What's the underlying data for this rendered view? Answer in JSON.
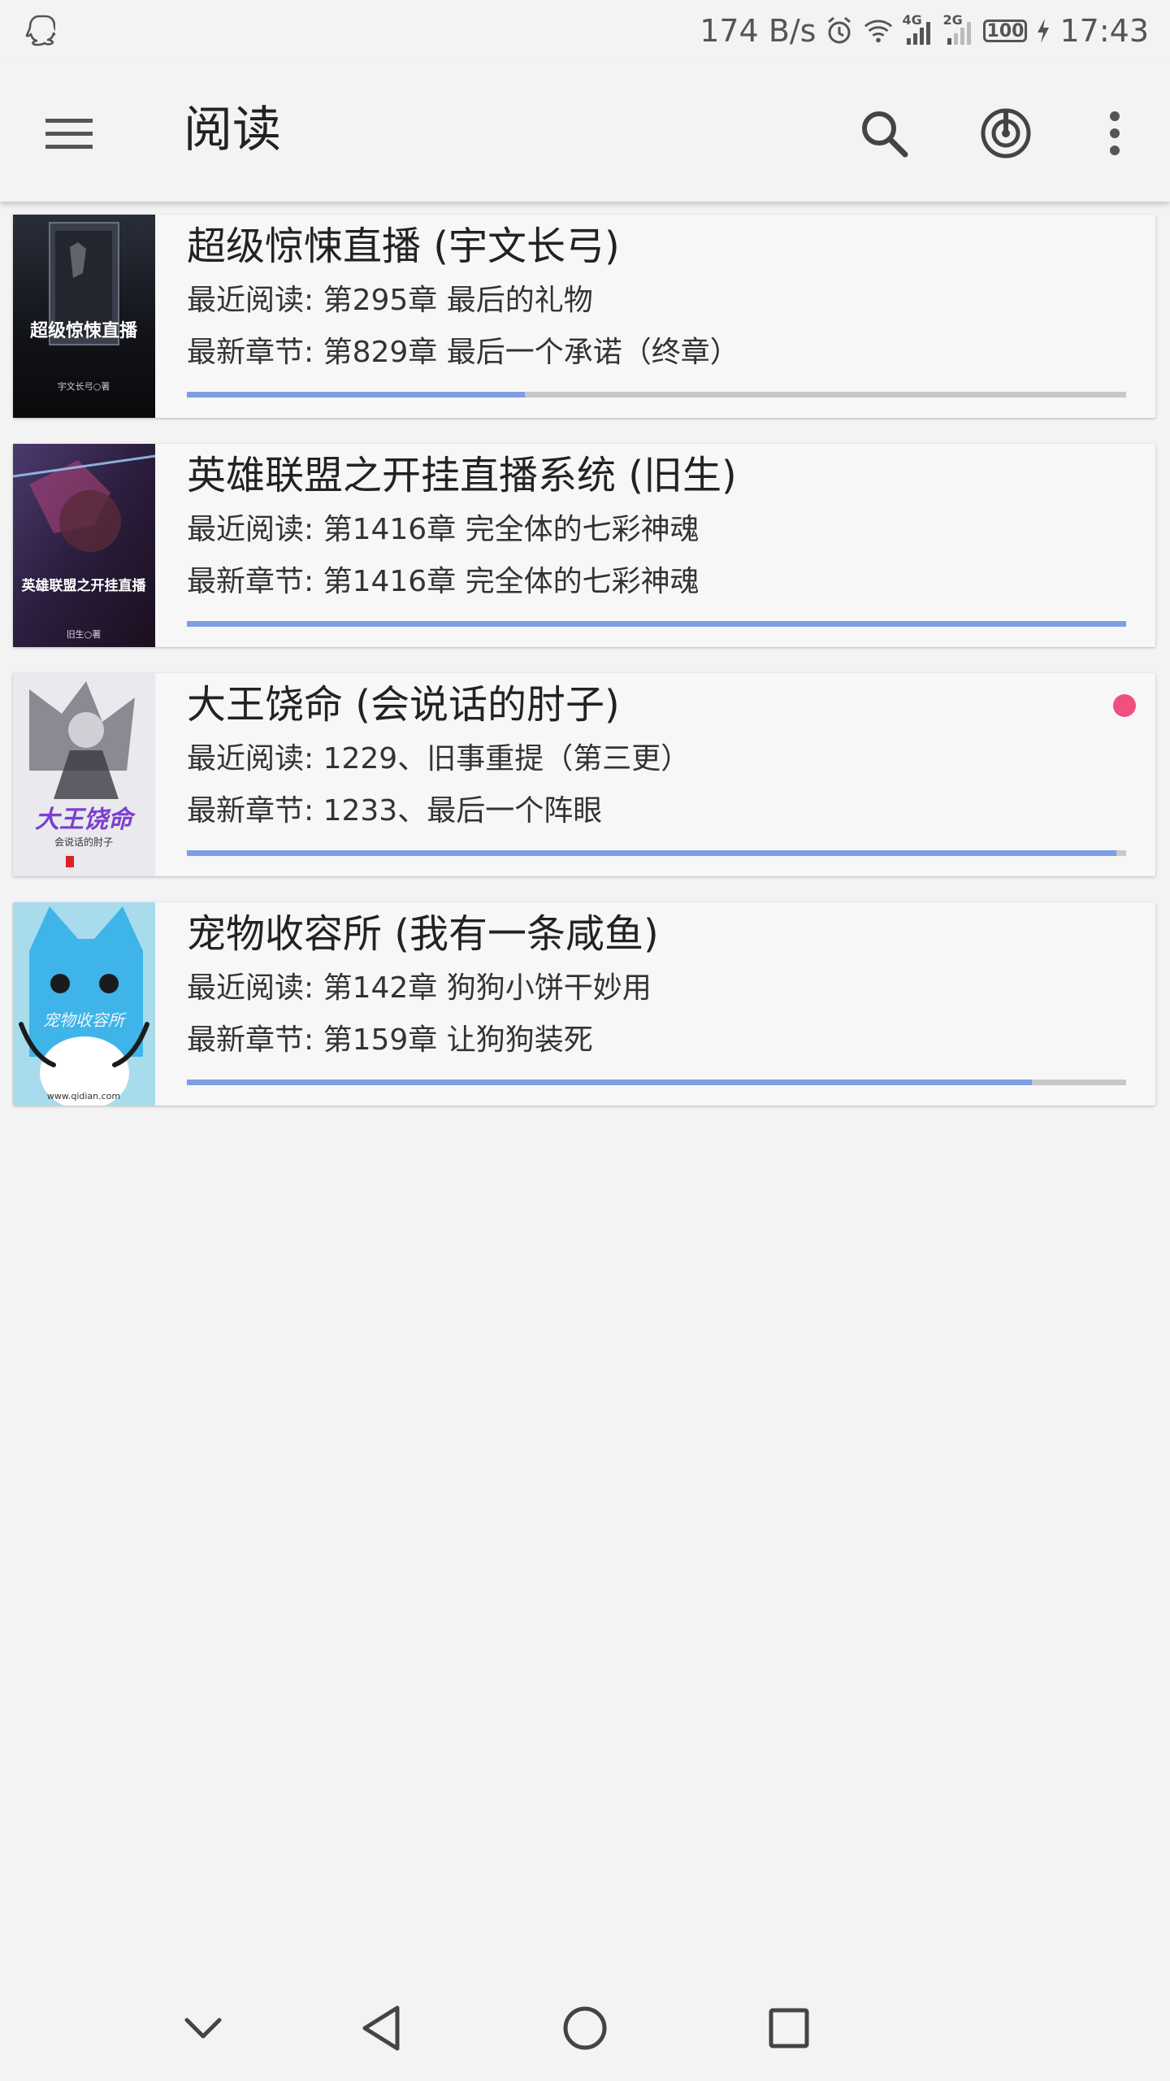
{
  "status_bar": {
    "net_speed": "174 B/s",
    "network_4g": "4G",
    "network_2g": "2G",
    "battery": "100",
    "time": "17:43"
  },
  "toolbar": {
    "title": "阅读"
  },
  "books": [
    {
      "title": "超级惊悚直播 (宇文长弓)",
      "recent": "最近阅读: 第295章 最后的礼物",
      "latest": "最新章节: 第829章 最后一个承诺（终章）",
      "progress": 0.36,
      "cover_text": "超级惊悚直播",
      "cover_author": "宇文长弓○著",
      "has_update": false
    },
    {
      "title": "英雄联盟之开挂直播系统 (旧生)",
      "recent": "最近阅读: 第1416章 完全体的七彩神魂",
      "latest": "最新章节: 第1416章 完全体的七彩神魂",
      "progress": 1.0,
      "cover_text": "英雄联盟之开挂直播",
      "cover_author": "旧生○著",
      "has_update": false
    },
    {
      "title": "大王饶命 (会说话的肘子)",
      "recent": "最近阅读: 1229、旧事重提（第三更）",
      "latest": "最新章节: 1233、最后一个阵眼",
      "progress": 0.99,
      "cover_text": "大王饶命",
      "cover_author": "会说话的肘子",
      "has_update": true
    },
    {
      "title": "宠物收容所 (我有一条咸鱼)",
      "recent": "最近阅读: 第142章 狗狗小饼干妙用",
      "latest": "最新章节: 第159章 让狗狗装死",
      "progress": 0.9,
      "cover_text": "宠物收容所",
      "cover_author": "www.qidian.com",
      "has_update": false
    }
  ],
  "colors": {
    "progress_fill": "#7d9de6",
    "progress_track": "#c8c8c8",
    "update_dot": "#f14f7d",
    "background": "#f3f3f3"
  },
  "icons": [
    "qq-icon",
    "alarm-icon",
    "wifi-icon",
    "signal-icon",
    "battery-icon",
    "charging-icon",
    "menu-icon",
    "search-icon",
    "radar-icon",
    "more-vert-icon",
    "chevron-down-icon",
    "back-icon",
    "home-icon",
    "recents-icon"
  ]
}
